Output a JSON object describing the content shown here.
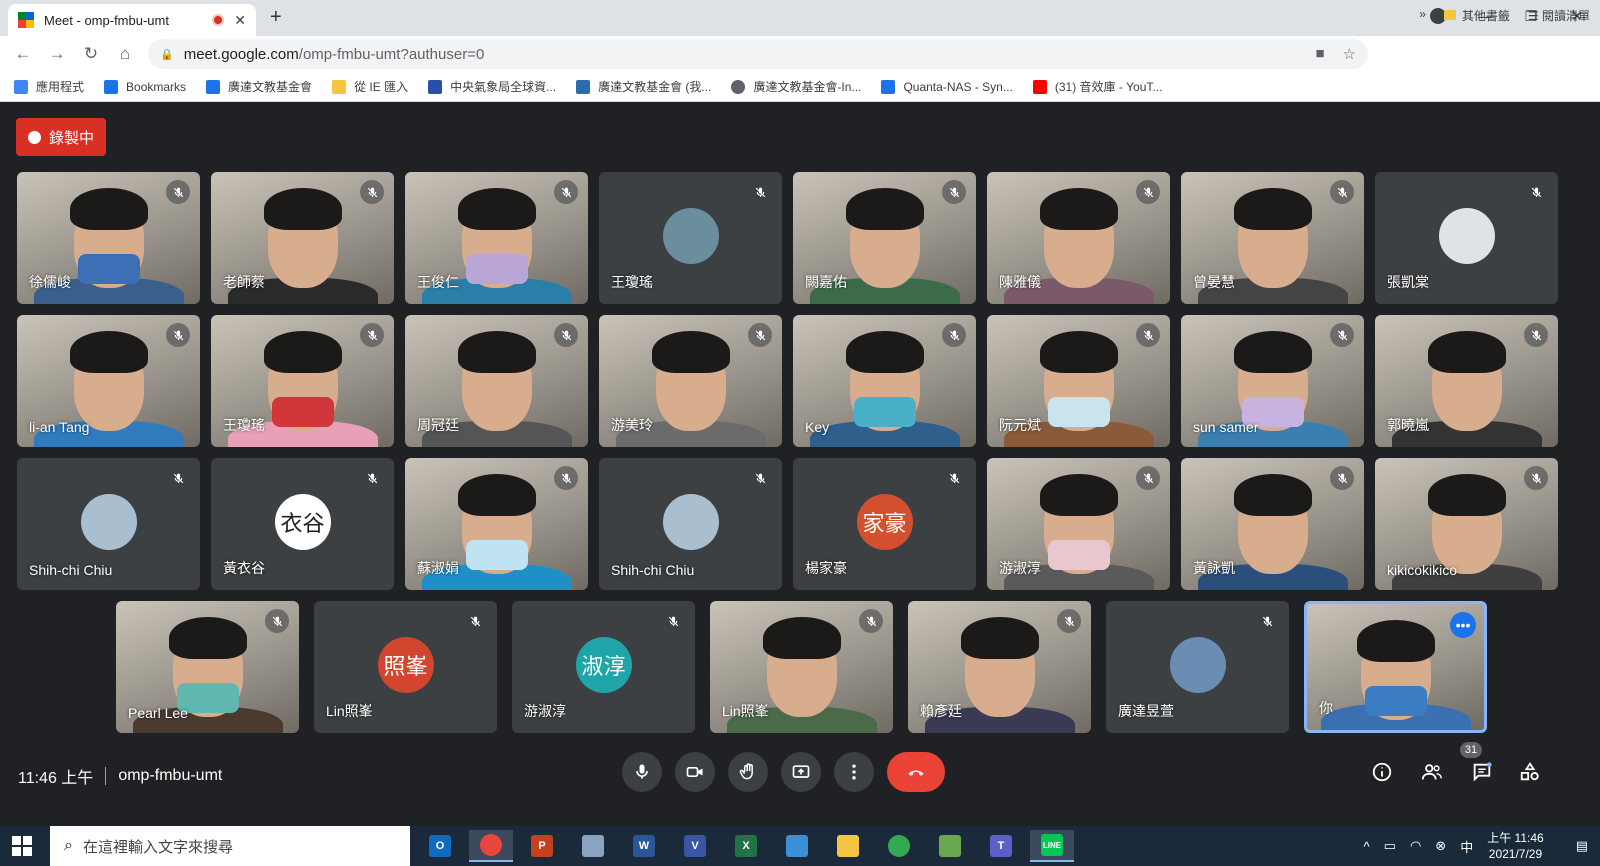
{
  "browser": {
    "tab_title": "Meet - omp-fmbu-umt",
    "url_host": "meet.google.com",
    "url_path": "/omp-fmbu-umt?authuser=0",
    "close_glyph": "✕",
    "new_tab_glyph": "+"
  },
  "bookmarks": [
    {
      "label": "應用程式",
      "icon": "apps-icon",
      "color": "#4285f4"
    },
    {
      "label": "Bookmarks",
      "icon": "star-icon",
      "color": "#1a73e8"
    },
    {
      "label": "廣達文教基金會",
      "icon": "quanta-icon",
      "color": "#1a73e8"
    },
    {
      "label": "從 IE 匯入",
      "icon": "folder-icon",
      "color": "#f4c542"
    },
    {
      "label": "中央氣象局全球資...",
      "icon": "cwb-icon",
      "color": "#2b4fa8"
    },
    {
      "label": "廣達文教基金會 (我...",
      "icon": "quanta-icon",
      "color": "#2b6cb0"
    },
    {
      "label": "廣達文教基金會-In...",
      "icon": "globe-icon",
      "color": "#5f6368"
    },
    {
      "label": "Quanta-NAS - Syn...",
      "icon": "dsm-icon",
      "color": "#1a73e8"
    },
    {
      "label": "(31) 音效庫 - YouT...",
      "icon": "youtube-icon",
      "color": "#ff0000"
    }
  ],
  "bookmarks_right": {
    "overflow": "»",
    "other": "其他書籤",
    "reading": "閱讀清單"
  },
  "meet": {
    "recording_label": "錄製中",
    "time": "11:46 上午",
    "meeting_code": "omp-fmbu-umt",
    "participant_count": "31",
    "self_label": "你"
  },
  "tiles": [
    {
      "name": "徐儒峻",
      "type": "video",
      "body": "#3a5f8c",
      "mask": "#3d6fb6"
    },
    {
      "name": "老師蔡",
      "type": "video",
      "body": "#2a2a2a",
      "mask": ""
    },
    {
      "name": "王俊仁",
      "type": "video",
      "body": "#2a7fa8",
      "mask": "#b9a6d6"
    },
    {
      "name": "王瓊瑤",
      "type": "avatar",
      "avatar_bg": "#6b8e9e",
      "avatar_text": ""
    },
    {
      "name": "闕嘉佑",
      "type": "video",
      "body": "#3c6b4a",
      "mask": ""
    },
    {
      "name": "陳雅儀",
      "type": "video",
      "body": "#7a5a6a",
      "mask": ""
    },
    {
      "name": "曾晏慧",
      "type": "video",
      "body": "#444",
      "mask": ""
    },
    {
      "name": "張凱棠",
      "type": "avatar",
      "avatar_bg": "#dfe3e8",
      "avatar_text": ""
    },
    {
      "name": "li-an Tang",
      "type": "video",
      "body": "#2f7bbd",
      "mask": ""
    },
    {
      "name": "王瓊瑤",
      "type": "video",
      "body": "#e8a0b8",
      "mask": "#d0363a"
    },
    {
      "name": "周冠廷",
      "type": "video",
      "body": "#555",
      "mask": ""
    },
    {
      "name": "游美玲",
      "type": "video",
      "body": "#6b6b6b",
      "mask": ""
    },
    {
      "name": "Key",
      "type": "video",
      "body": "#2f5f8a",
      "mask": "#4ab0c8"
    },
    {
      "name": "阮元斌",
      "type": "video",
      "body": "#8a5a3a",
      "mask": "#c9e4ee"
    },
    {
      "name": "sun samer",
      "type": "video",
      "body": "#3a7fb0",
      "mask": "#c8b3e0"
    },
    {
      "name": "郭曉嵐",
      "type": "video",
      "body": "#333",
      "mask": ""
    },
    {
      "name": "Shih-chi Chiu",
      "type": "avatar",
      "avatar_bg": "#a9bfcf",
      "avatar_text": ""
    },
    {
      "name": "黃衣谷",
      "type": "avatar",
      "avatar_bg": "#ffffff",
      "avatar_text": "衣谷"
    },
    {
      "name": "蘇淑娟",
      "type": "video",
      "body": "#1f8fc8",
      "mask": "#bfe3f2"
    },
    {
      "name": "Shih-chi Chiu",
      "type": "avatar",
      "avatar_bg": "#a9bfcf",
      "avatar_text": ""
    },
    {
      "name": "楊家豪",
      "type": "avatar",
      "avatar_bg": "#d3502e",
      "avatar_text": "家豪"
    },
    {
      "name": "游淑淳",
      "type": "video",
      "body": "#5a5a5a",
      "mask": "#e8c7cf"
    },
    {
      "name": "黃詠凱",
      "type": "video",
      "body": "#2b4f7a",
      "mask": ""
    },
    {
      "name": "kikicokikico",
      "type": "video",
      "body": "#3f3f3f",
      "mask": ""
    },
    {
      "name": "Pearl Lee",
      "type": "video",
      "body": "#4a3a30",
      "mask": "#5fb7b0"
    },
    {
      "name": "Lin照峯",
      "type": "avatar",
      "avatar_bg": "#d2452e",
      "avatar_text": "照峯"
    },
    {
      "name": "游淑淳",
      "type": "avatar",
      "avatar_bg": "#1ea5a8",
      "avatar_text": "淑淳"
    },
    {
      "name": "Lin照峯",
      "type": "video",
      "body": "#4a6a4a",
      "mask": ""
    },
    {
      "name": "賴彥廷",
      "type": "video",
      "body": "#3a3a55",
      "mask": ""
    },
    {
      "name": "廣達昱萱",
      "type": "avatar",
      "avatar_bg": "#6c8db2",
      "avatar_text": ""
    },
    {
      "name": "你",
      "type": "self",
      "body": "#3a6fb0",
      "mask": "#3b7cc2"
    }
  ],
  "taskbar": {
    "search_placeholder": "在這裡輸入文字來搜尋",
    "clock_time": "上午 11:46",
    "clock_date": "2021/7/29",
    "apps": [
      {
        "label": "O",
        "icon": "outlook-icon",
        "color": "#0f6cbd"
      },
      {
        "label": "",
        "icon": "chrome-icon",
        "color": "#e8453c"
      },
      {
        "label": "P",
        "icon": "powerpoint-icon",
        "color": "#c4401f"
      },
      {
        "label": "",
        "icon": "paint-icon",
        "color": "#8aa3c0"
      },
      {
        "label": "W",
        "icon": "word-icon",
        "color": "#2b579a"
      },
      {
        "label": "V",
        "icon": "visio-icon",
        "color": "#3955a3"
      },
      {
        "label": "X",
        "icon": "excel-icon",
        "color": "#217346"
      },
      {
        "label": "",
        "icon": "remote-desktop-icon",
        "color": "#3a8fd6"
      },
      {
        "label": "",
        "icon": "file-explorer-icon",
        "color": "#f3c541"
      },
      {
        "label": "",
        "icon": "chrome-profile-icon",
        "color": "#34a853"
      },
      {
        "label": "",
        "icon": "rocket-icon",
        "color": "#6aa84f"
      },
      {
        "label": "T",
        "icon": "teams-icon",
        "color": "#5b5fc7"
      },
      {
        "label": "LINE",
        "icon": "line-icon",
        "color": "#06c755"
      }
    ]
  }
}
